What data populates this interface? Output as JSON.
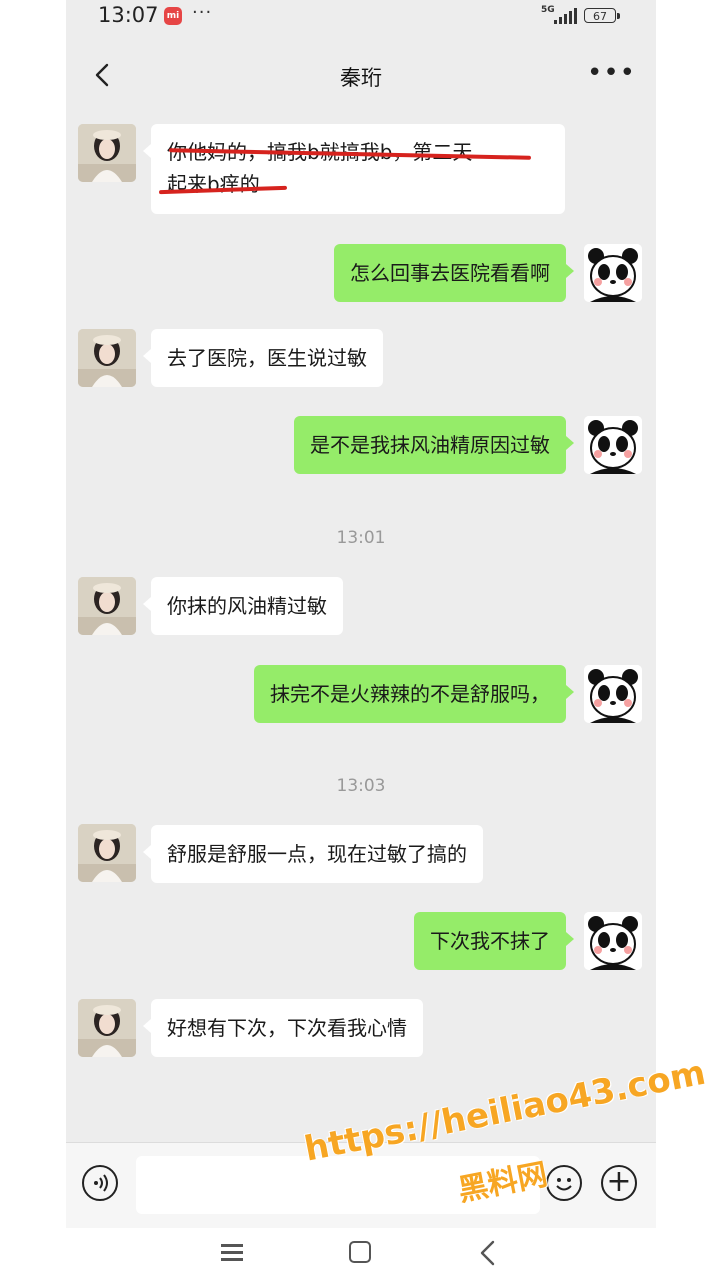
{
  "status_bar": {
    "time": "13:07",
    "app_badge": "mi",
    "more": "···",
    "network": "5G",
    "battery": "67"
  },
  "header": {
    "title": "秦珩",
    "back_icon": "chevron-left-icon",
    "more_icon": "more-dots-icon"
  },
  "messages": [
    {
      "side": "left",
      "avatar": "girl-avatar",
      "lines": [
        "你他妈的，搞我b就搞我b，第二天",
        "起来b痒的"
      ],
      "struck": true
    },
    {
      "side": "right",
      "avatar": "panda-avatar",
      "text": "怎么回事去医院看看啊"
    },
    {
      "side": "left",
      "avatar": "girl-avatar",
      "text": "去了医院，医生说过敏"
    },
    {
      "side": "right",
      "avatar": "panda-avatar",
      "text": "是不是我抹风油精原因过敏"
    },
    {
      "timestamp": "13:01"
    },
    {
      "side": "left",
      "avatar": "girl-avatar",
      "text": "你抹的风油精过敏"
    },
    {
      "side": "right",
      "avatar": "panda-avatar",
      "text": "抹完不是火辣辣的不是舒服吗，"
    },
    {
      "timestamp": "13:03"
    },
    {
      "side": "left",
      "avatar": "girl-avatar",
      "text": "舒服是舒服一点，现在过敏了搞的"
    },
    {
      "side": "right",
      "avatar": "panda-avatar",
      "text": "下次我不抹了"
    },
    {
      "side": "left",
      "avatar": "girl-avatar",
      "text": "好想有下次，下次看我心情"
    }
  ],
  "input_bar": {
    "voice_icon": "voice-icon",
    "emoji_icon": "emoji-icon",
    "plus_icon": "plus-icon",
    "placeholder": ""
  },
  "nav_bar": {
    "menu_icon": "menu-icon",
    "home_icon": "home-icon",
    "back_icon": "back-icon"
  },
  "watermark": {
    "url": "https://heiliao43.com",
    "name": "黑料网"
  },
  "colors": {
    "chat_bg": "#ededed",
    "incoming_bubble": "#ffffff",
    "outgoing_bubble": "#95ec69",
    "strike": "#d6231e",
    "watermark": "#f7a623"
  }
}
